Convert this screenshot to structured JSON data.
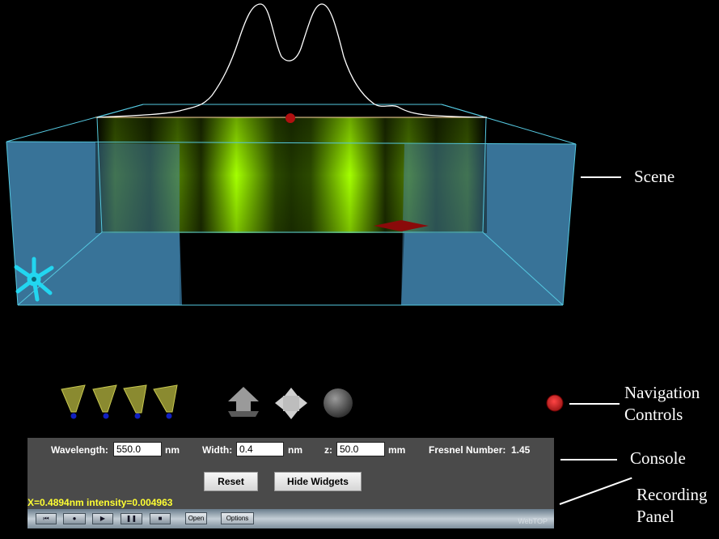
{
  "callouts": {
    "scene": "Scene",
    "navigation_line1": "Navigation",
    "navigation_line2": "Controls",
    "console": "Console",
    "recording_line1": "Recording",
    "recording_line2": "Panel"
  },
  "console": {
    "wavelength_label": "Wavelength:",
    "wavelength_value": "550.0",
    "wavelength_unit": "nm",
    "width_label": "Width:",
    "width_value": "0.4",
    "width_unit": "nm",
    "z_label": "z:",
    "z_value": "50.0",
    "z_unit": "mm",
    "fresnel_label": "Fresnel Number:",
    "fresnel_value": "1.45",
    "reset_label": "Reset",
    "hide_widgets_label": "Hide Widgets",
    "readout": "X=0.4894nm  intensity=0.004963"
  },
  "recording": {
    "open_label": "Open",
    "options_label": "Options",
    "brand": "WebTOP",
    "icons": [
      "rewind-icon",
      "record-icon",
      "play-icon",
      "pause-icon",
      "stop-icon"
    ]
  },
  "colors": {
    "box_fill": "#3a7ea8",
    "box_edge": "#55c8e0",
    "fringe_green": "#a4ff00",
    "widget_cyan": "#22d6f0",
    "marker_red": "#b01010",
    "console_bg": "#4a4a4a",
    "readout_yellow": "#ffff33"
  }
}
